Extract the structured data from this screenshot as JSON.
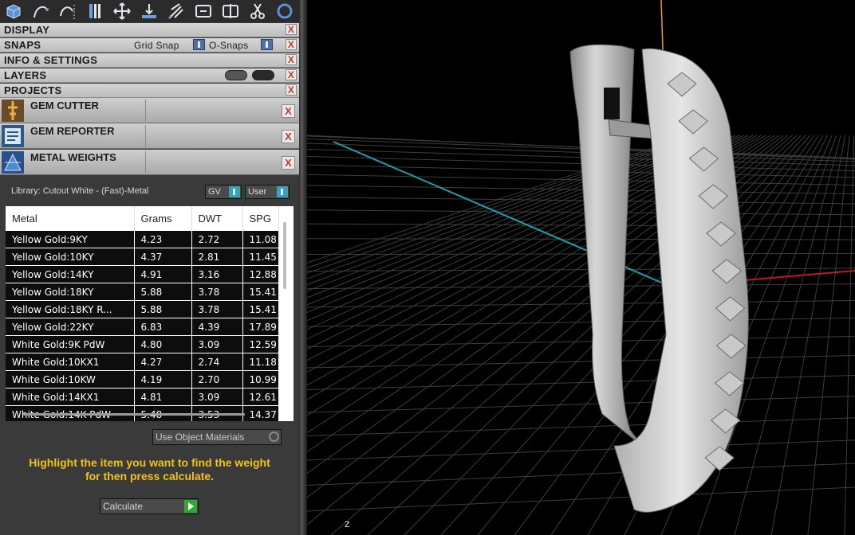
{
  "toolbar": {
    "icons": [
      "cube-icon",
      "curve-icon",
      "arc-icon",
      "columns-icon",
      "move-icon",
      "drop-icon",
      "sparkle-icon",
      "link-icon",
      "mirror-icon",
      "scissors-icon",
      "ring-icon"
    ]
  },
  "panels": {
    "display": "DISPLAY",
    "snaps": "SNAPS",
    "grid_snap": "Grid Snap",
    "o_snaps": "O-Snaps",
    "info": "INFO & SETTINGS",
    "layers": "LAYERS",
    "projects": "PROJECTS",
    "close_glyph": "X"
  },
  "plugins": [
    {
      "title": "GEM CUTTER",
      "icon": "gem-cutter-icon"
    },
    {
      "title": "GEM REPORTER",
      "icon": "gem-reporter-icon"
    },
    {
      "title": "METAL WEIGHTS",
      "icon": "metal-weights-icon"
    }
  ],
  "library": {
    "label": "Library: Cutout White - (Fast)-Metal",
    "gv": "GV",
    "user": "User"
  },
  "table": {
    "columns": [
      "Metal",
      "Grams",
      "DWT",
      "SPG"
    ],
    "rows": [
      [
        "Yellow Gold:9KY",
        "4.23",
        "2.72",
        "11.08"
      ],
      [
        "Yellow Gold:10KY",
        "4.37",
        "2.81",
        "11.45"
      ],
      [
        "Yellow Gold:14KY",
        "4.91",
        "3.16",
        "12.88"
      ],
      [
        "Yellow Gold:18KY",
        "5.88",
        "3.78",
        "15.41"
      ],
      [
        "Yellow Gold:18KY R...",
        "5.88",
        "3.78",
        "15.41"
      ],
      [
        "Yellow Gold:22KY",
        "6.83",
        "4.39",
        "17.89"
      ],
      [
        "White Gold:9K PdW",
        "4.80",
        "3.09",
        "12.59"
      ],
      [
        "White Gold:10KX1",
        "4.27",
        "2.74",
        "11.18"
      ],
      [
        "White Gold:10KW",
        "4.19",
        "2.70",
        "10.99"
      ],
      [
        "White Gold:14KX1",
        "4.81",
        "3.09",
        "12.61"
      ],
      [
        "White Gold:14K PdW",
        "5.48",
        "3.53",
        "14.37"
      ]
    ]
  },
  "object_materials": "Use Object Materials",
  "hint_line1": "Highlight the item you want to find the weight",
  "hint_line2": "for then press calculate.",
  "calculate": "Calculate",
  "viewport": {
    "axis_label": "z"
  },
  "colors": {
    "panel_bg": "#3a3a3a",
    "hint": "#f4c21a",
    "accent_blue": "#4f6fa8",
    "go_green": "#2fa836",
    "axis_y": "#e89a1a",
    "axis_x": "#c01818",
    "axis_z": "#1aa0b0"
  }
}
